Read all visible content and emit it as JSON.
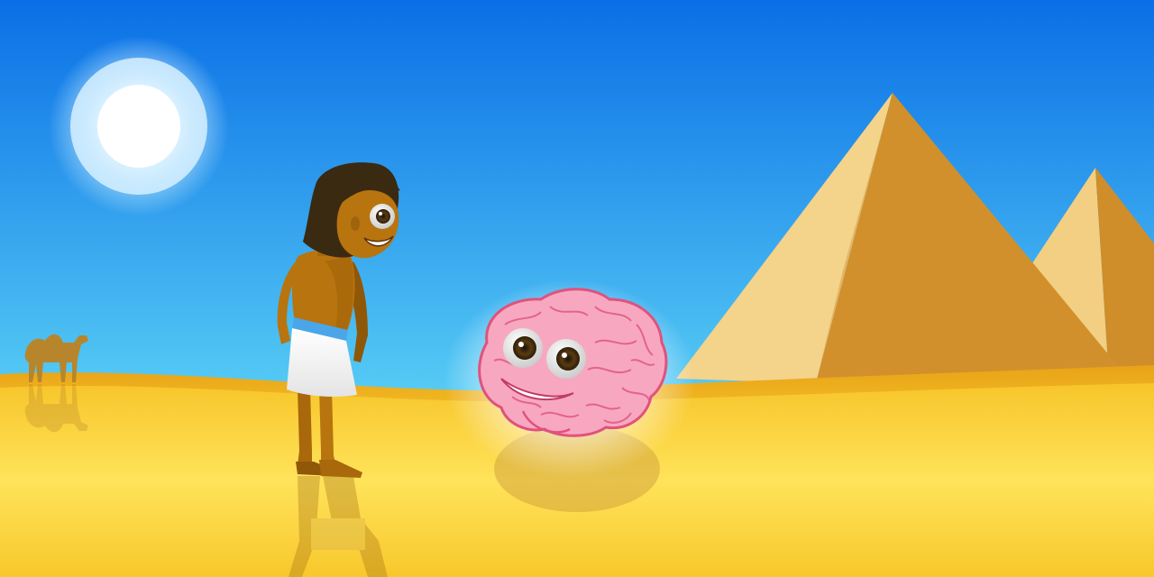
{
  "scene": {
    "subjects": [
      "sun-icon",
      "pyramid-large",
      "pyramid-small",
      "camel-icon",
      "egyptian-boy",
      "cartoon-brain"
    ]
  },
  "colors": {
    "sky_top": "#0a6fe6",
    "sky_bottom": "#5ad0f5",
    "sun": "#ffffff",
    "sun_glow": "#cfefff",
    "sand_light": "#ffe35a",
    "sand_mid": "#f7c52a",
    "sand_dark": "#e8a317",
    "pyramid_lit": "#f2cf83",
    "pyramid_shade": "#cf8e2a",
    "skin": "#b8740e",
    "skin_dark": "#8f5708",
    "hair": "#3a2a12",
    "kilt": "#ffffff",
    "belt": "#4aa6e8",
    "brain": "#f7a8c0",
    "brain_line": "#e0527e",
    "camel": "#b7862c"
  }
}
